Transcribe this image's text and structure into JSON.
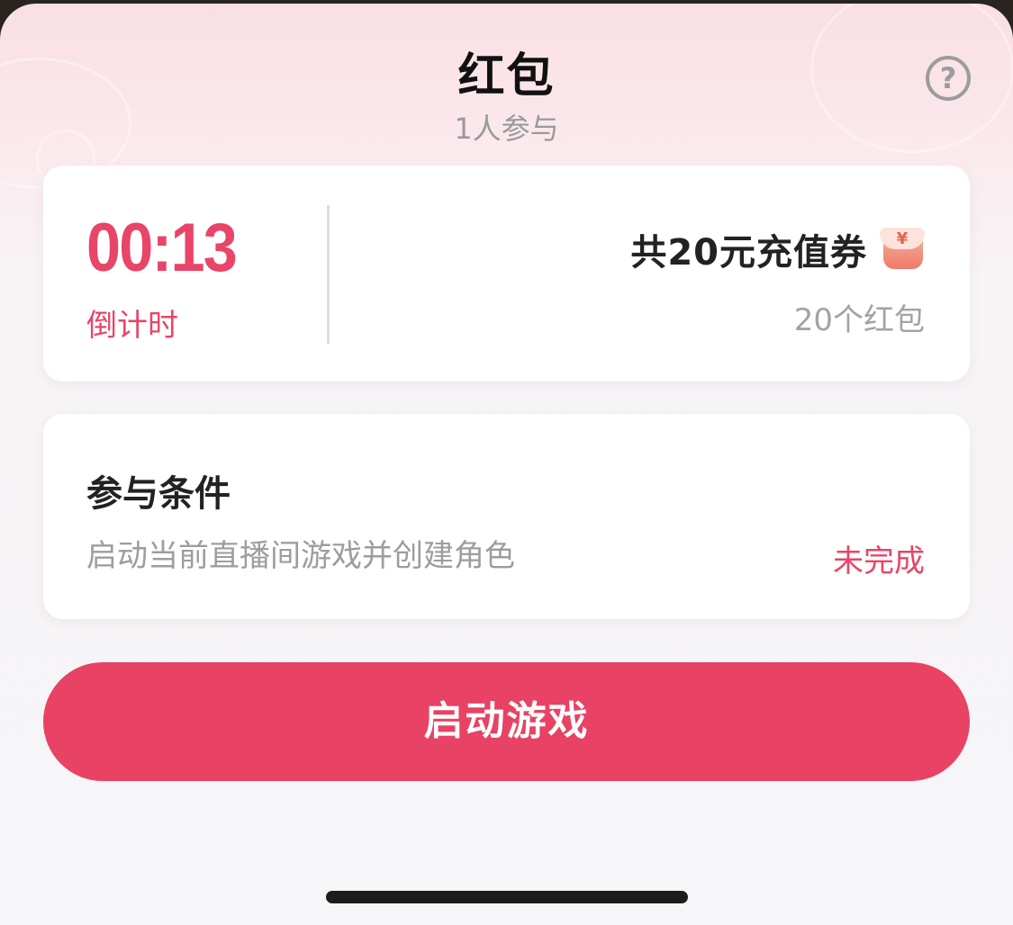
{
  "header": {
    "title": "红包",
    "participants": "1人参与",
    "help_icon": "question-circle-icon",
    "help_glyph": "?"
  },
  "summary_card": {
    "countdown_value": "00:13",
    "countdown_label": "倒计时",
    "total_reward": "共20元充值券",
    "reward_icon": "red-envelope-voucher-icon",
    "reward_icon_glyph": "¥",
    "packet_count": "20个红包"
  },
  "condition_card": {
    "title": "参与条件",
    "description": "启动当前直播间游戏并创建角色",
    "status": "未完成"
  },
  "actions": {
    "start_game_label": "启动游戏"
  },
  "colors": {
    "accent": "#e84264",
    "text_primary": "#222222",
    "text_secondary": "#9d9d9d"
  }
}
